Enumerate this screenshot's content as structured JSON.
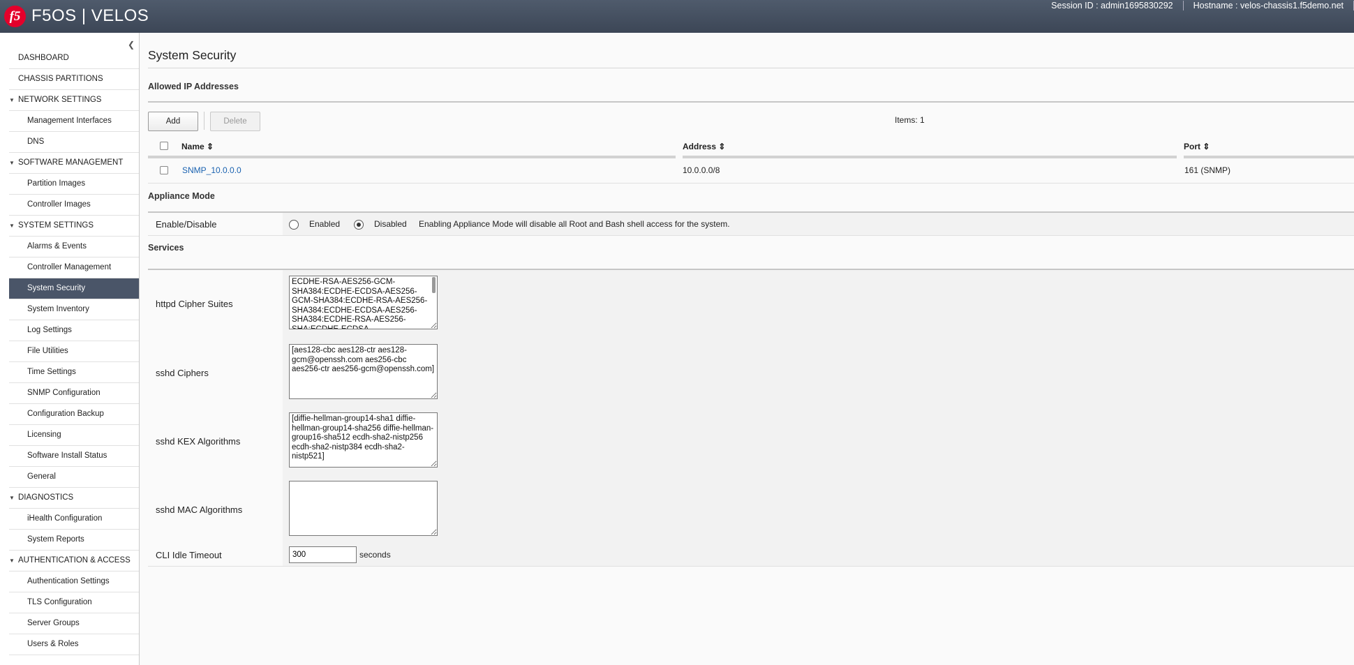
{
  "header": {
    "logo": "f5",
    "brand": "F5OS | VELOS",
    "session": "Session ID : admin1695830292",
    "hostname": "Hostname : velos-chassis1.f5demo.net"
  },
  "sidebar": {
    "collapse_icon": "chevron-left-icon",
    "top_items": [
      "DASHBOARD",
      "CHASSIS PARTITIONS"
    ],
    "sections": [
      {
        "label": "NETWORK SETTINGS",
        "items": [
          "Management Interfaces",
          "DNS"
        ]
      },
      {
        "label": "SOFTWARE MANAGEMENT",
        "items": [
          "Partition Images",
          "Controller Images"
        ]
      },
      {
        "label": "SYSTEM SETTINGS",
        "items": [
          "Alarms & Events",
          "Controller Management",
          "System Security",
          "System Inventory",
          "Log Settings",
          "File Utilities",
          "Time Settings",
          "SNMP Configuration",
          "Configuration Backup",
          "Licensing",
          "Software Install Status",
          "General"
        ]
      },
      {
        "label": "DIAGNOSTICS",
        "items": [
          "iHealth Configuration",
          "System Reports"
        ]
      },
      {
        "label": "AUTHENTICATION & ACCESS",
        "items": [
          "Authentication Settings",
          "TLS Configuration",
          "Server Groups",
          "Users & Roles"
        ]
      }
    ],
    "active": "System Security"
  },
  "main": {
    "title": "System Security",
    "allowed_ip": {
      "title": "Allowed IP Addresses",
      "add_label": "Add",
      "delete_label": "Delete",
      "items_count": "Items: 1",
      "columns": [
        "Name",
        "Address",
        "Port"
      ],
      "rows": [
        {
          "name": "SNMP_10.0.0.0",
          "address": "10.0.0.0/8",
          "port": "161 (SNMP)"
        }
      ]
    },
    "appliance": {
      "title": "Appliance Mode",
      "label": "Enable/Disable",
      "enabled_label": "Enabled",
      "disabled_label": "Disabled",
      "selected": "Disabled",
      "note": "Enabling Appliance Mode will disable all Root and Bash shell access for the system."
    },
    "services": {
      "title": "Services",
      "httpd_label": "httpd Cipher Suites",
      "httpd_value": "ECDHE-RSA-AES256-GCM-SHA384:ECDHE-ECDSA-AES256-GCM-SHA384:ECDHE-RSA-AES256-SHA384:ECDHE-ECDSA-AES256-SHA384:ECDHE-RSA-AES256-SHA:ECDHE-ECDSA-",
      "ciphers_label": "sshd Ciphers",
      "ciphers_value": "[aes128-cbc aes128-ctr aes128-gcm@openssh.com aes256-cbc aes256-ctr aes256-gcm@openssh.com]",
      "kex_label": "sshd KEX Algorithms",
      "kex_value": "[diffie-hellman-group14-sha1 diffie-hellman-group14-sha256 diffie-hellman-group16-sha512 ecdh-sha2-nistp256 ecdh-sha2-nistp384 ecdh-sha2-nistp521]",
      "mac_label": "sshd MAC Algorithms",
      "mac_value": "",
      "cli_label": "CLI Idle Timeout",
      "cli_value": "300",
      "cli_unit": "seconds"
    }
  }
}
